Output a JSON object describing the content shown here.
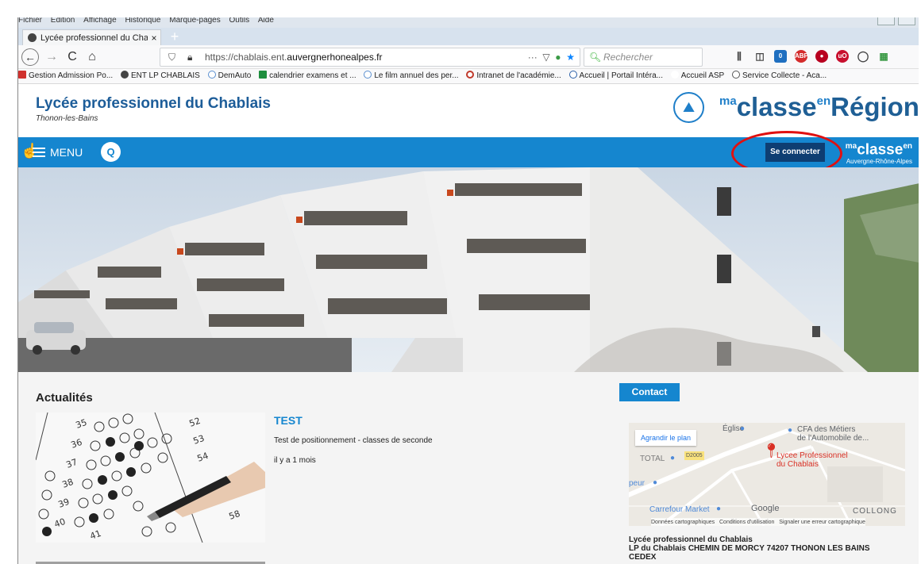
{
  "menubar": [
    "Fichier",
    "Edition",
    "Affichage",
    "Historique",
    "Marque-pages",
    "Outils",
    "Aide"
  ],
  "tab": {
    "title": "Lycée professionnel du Chabla",
    "close": "×"
  },
  "newtab": "+",
  "nav": {
    "back": "←",
    "forward": "→",
    "reload": "C",
    "home": "⌂",
    "url_prefix": "https://chablais.ent.",
    "url_host": "auvergnerhonealpes.fr",
    "url_actions": "··· ▽ ● ★",
    "search_placeholder": "Rechercher"
  },
  "bookmarks": [
    {
      "label": "Gestion Admission Po...",
      "color": "#d0312d"
    },
    {
      "label": "ENT LP CHABLAIS",
      "color": "#444444"
    },
    {
      "label": "DemAuto",
      "color": "#5a8fd0"
    },
    {
      "label": "calendrier examens et ...",
      "color": "#1e8e3e"
    },
    {
      "label": "Le film annuel des per...",
      "color": "#5a8fd0"
    },
    {
      "label": "Intranet de l'académie...",
      "color": "#c0392b"
    },
    {
      "label": "Accueil | Portail Intéra...",
      "color": "#2b5fa8"
    },
    {
      "label": "Accueil ASP",
      "color": "#ffffff"
    },
    {
      "label": "Service Collecte - Aca...",
      "color": "#555555"
    }
  ],
  "site": {
    "title": "Lycée professionnel du Chablais",
    "subtitle": "Thonon-les-Bains",
    "logo_ma": "ma",
    "logo_classe": "classe",
    "logo_en": "en",
    "logo_region": "Région"
  },
  "bluebar": {
    "menu_label": "MENU",
    "connect_label": "Se connecter",
    "mini_ma": "ma",
    "mini_classe": "classe",
    "mini_en": "en",
    "mini_region": "Auvergne-Rhône-Alpes"
  },
  "news": {
    "heading": "Actualités",
    "item_title": "TEST",
    "item_desc": "Test de positionnement - classes de seconde",
    "item_date": "il y a 1 mois"
  },
  "contact": {
    "button": "Contact",
    "map_enlarge": "Agrandir le plan",
    "map_labels": {
      "eglise": "Église",
      "cfa1": "CFA des Métiers",
      "cfa2": "de l'Automobile de...",
      "total": "TOTAL",
      "road": "D2005",
      "lycee1": "Lycee Professionnel",
      "lycee2": "du Chablais",
      "peur": "peur",
      "carrefour": "Carrefour Market",
      "google": "Google",
      "collong": "COLLONG",
      "footer": "Données cartographiques   Conditions d'utilisation   Signaler une erreur cartographique"
    },
    "address_name": "Lycée professionnel du Chablais",
    "address_line": "LP du Chablais CHEMIN DE MORCY 74207 THONON LES BAINS",
    "address_cedex": "CEDEX"
  },
  "colors": {
    "brand_blue": "#1586cf",
    "connect_navy": "#0e3e72",
    "annotation_red": "#e01010"
  }
}
